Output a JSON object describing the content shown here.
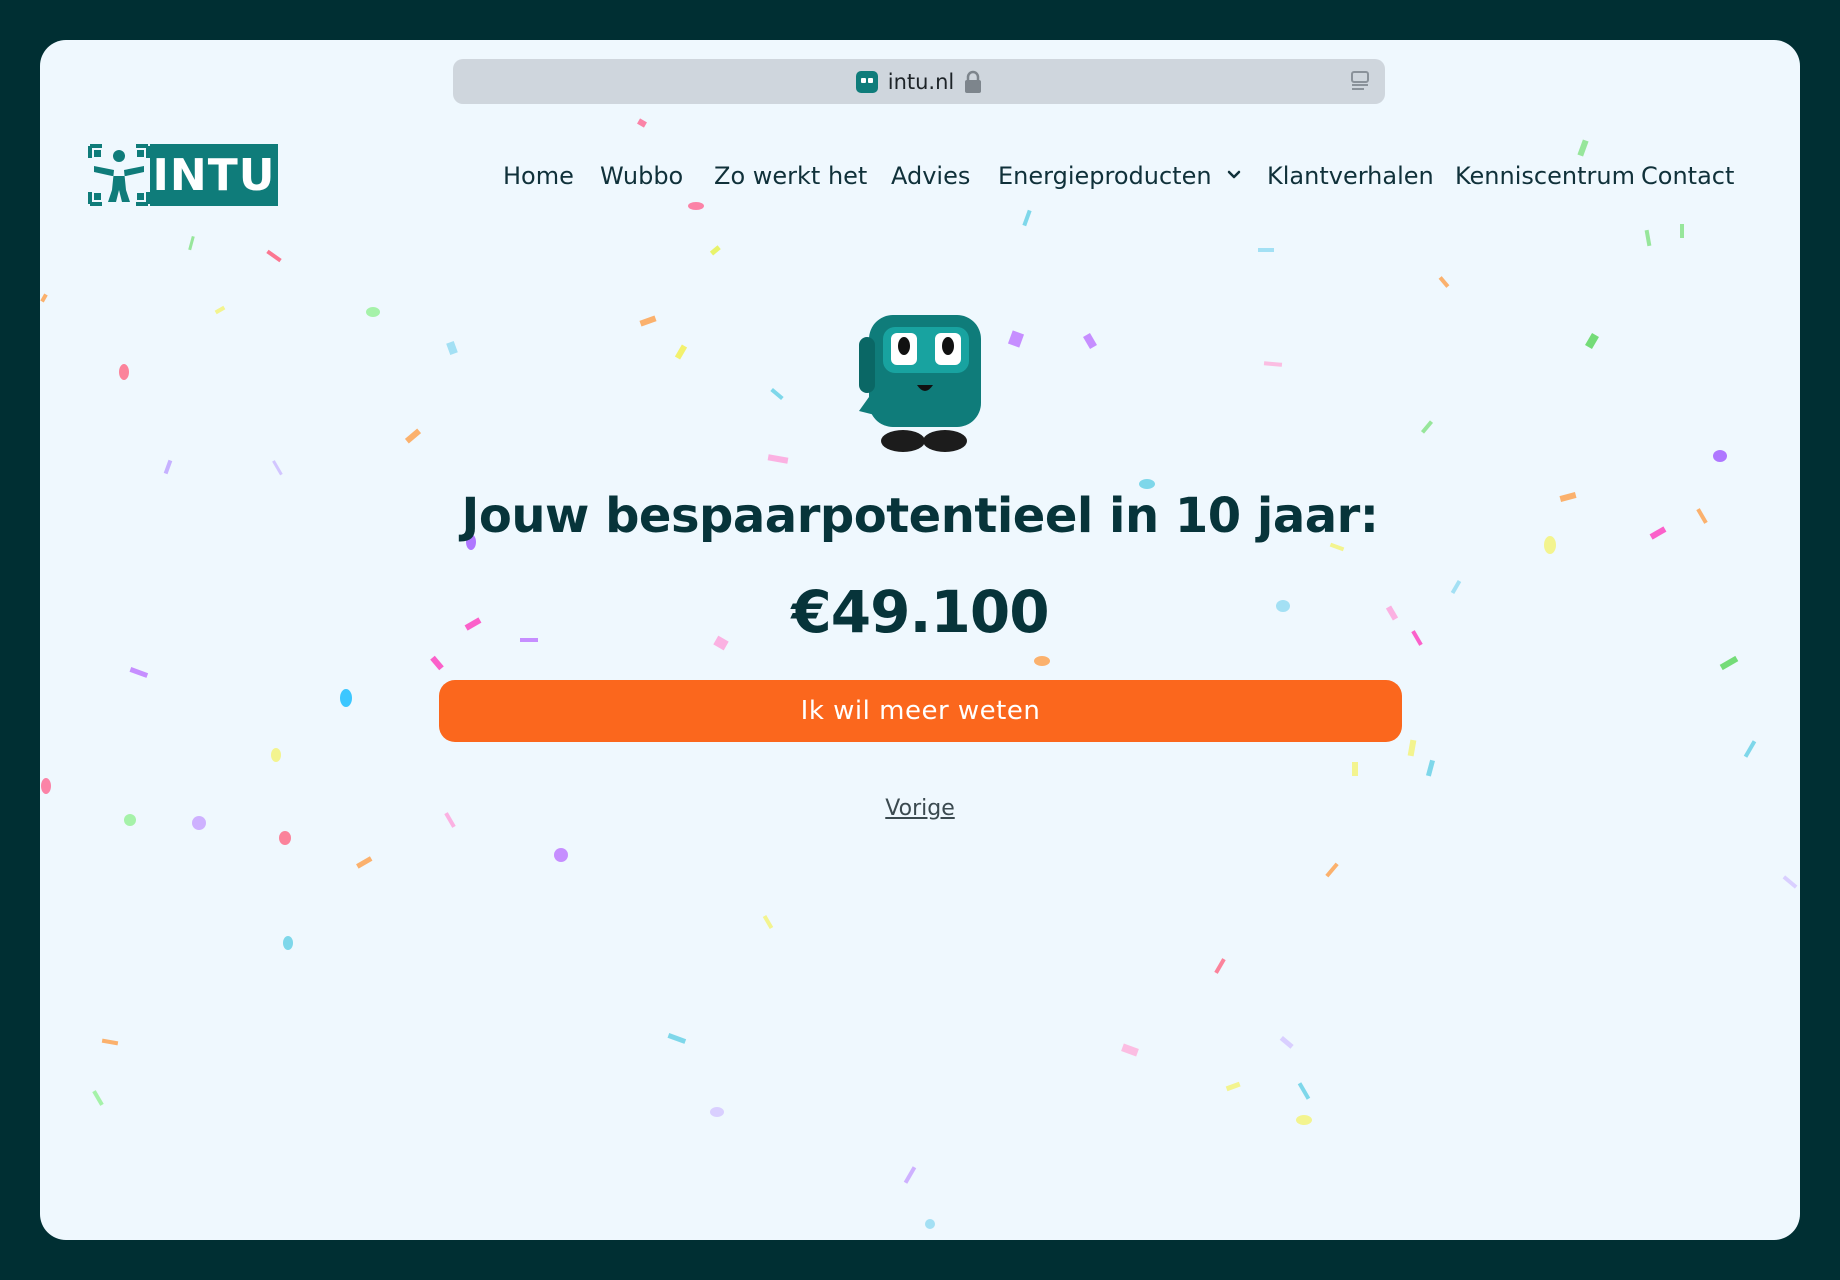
{
  "browser": {
    "url": "intu.nl",
    "favicon": "intu-robot-icon",
    "lock_icon": "lock-icon",
    "reader_icon": "reader-mode-icon"
  },
  "header": {
    "logo_text": "INTU",
    "nav": [
      {
        "label": "Home"
      },
      {
        "label": "Wubbo"
      },
      {
        "label": "Zo werkt het"
      },
      {
        "label": "Advies"
      },
      {
        "label": "Energieproducten",
        "has_dropdown": true
      },
      {
        "label": "Klantverhalen"
      },
      {
        "label": "Kenniscentrum"
      },
      {
        "label": "Contact"
      }
    ]
  },
  "result": {
    "mascot": "wubbo-robot-mascot",
    "headline": "Jouw bespaarpotentieel in 10 jaar:",
    "amount": "€49.100",
    "cta_label": "Ik wil meer weten",
    "back_label": "Vorige"
  },
  "colors": {
    "background": "#eff8fe",
    "frame": "#002f33",
    "brand_teal": "#0f7c7a",
    "text_dark": "#07343a",
    "cta_orange": "#fb671d"
  }
}
